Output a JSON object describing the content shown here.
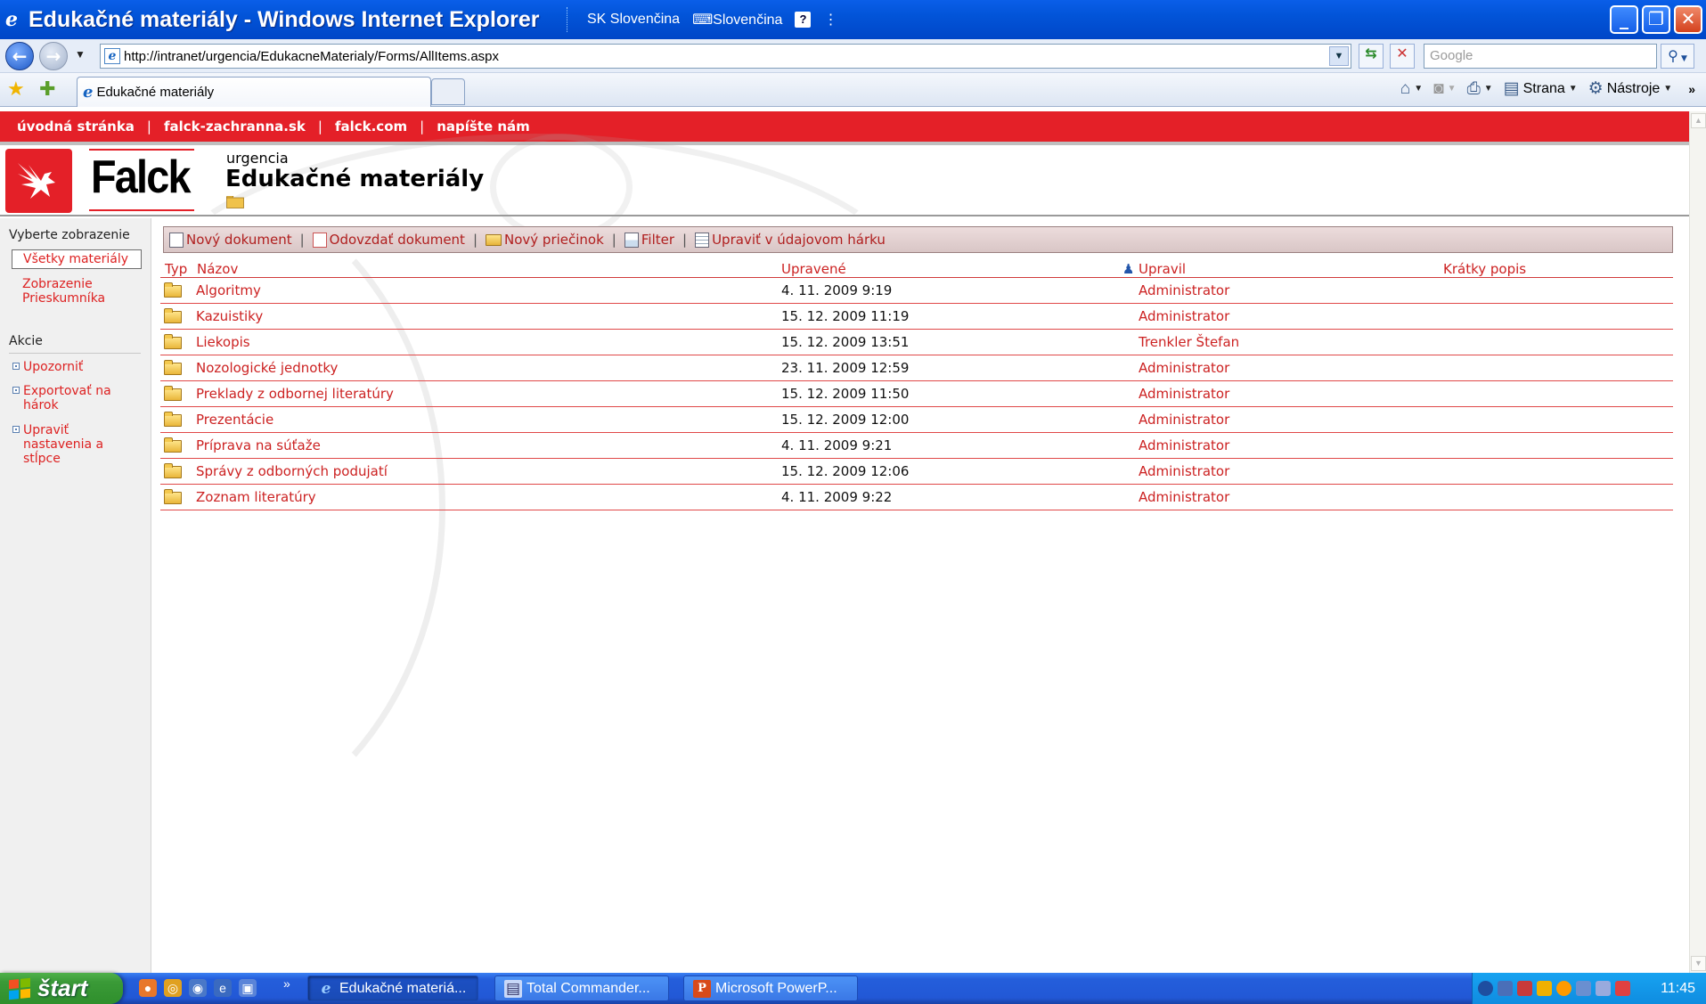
{
  "window": {
    "title": "Edukačné materiály - Windows Internet Explorer",
    "language_bar": {
      "lang_code_label": "SK Slovenčina",
      "keyboard_label": "Slovenčina",
      "help_label": "?"
    }
  },
  "address_bar": {
    "url": "http://intranet/urgencia/EdukacneMaterialy/Forms/AllItems.aspx",
    "search_placeholder": "Google"
  },
  "tabs": [
    {
      "label": "Edukačné materiály"
    }
  ],
  "command_bar": {
    "page_label": "Strana",
    "tools_label": "Nástroje"
  },
  "top_nav": {
    "links": [
      "úvodná stránka",
      "falck-zachranna.sk",
      "falck.com",
      "napíšte nám"
    ],
    "separator": "|"
  },
  "header": {
    "logo_text": "Falck",
    "site_name": "urgencia",
    "page_title": "Edukačné materiály"
  },
  "left_nav": {
    "views_heading": "Vyberte zobrazenie",
    "views": [
      "Všetky materiály",
      "Zobrazenie Prieskumníka"
    ],
    "actions_heading": "Akcie",
    "actions": [
      "Upozorniť",
      "Exportovať na hárok",
      "Upraviť nastavenia a stĺpce"
    ]
  },
  "toolbar": {
    "new_document": "Nový dokument",
    "upload_document": "Odovzdať dokument",
    "new_folder": "Nový priečinok",
    "filter": "Filter",
    "edit_datasheet": "Upraviť v údajovom hárku",
    "separator": "|"
  },
  "list": {
    "columns": {
      "type": "Typ",
      "name": "Názov",
      "modified": "Upravené",
      "modified_by": "Upravil",
      "description": "Krátky popis"
    },
    "rows": [
      {
        "name": "Algoritmy",
        "modified": "4. 11. 2009 9:19",
        "modified_by": "Administrator"
      },
      {
        "name": "Kazuistiky",
        "modified": "15. 12. 2009 11:19",
        "modified_by": "Administrator"
      },
      {
        "name": "Liekopis",
        "modified": "15. 12. 2009 13:51",
        "modified_by": "Trenkler Štefan"
      },
      {
        "name": "Nozologické jednotky",
        "modified": "23. 11. 2009 12:59",
        "modified_by": "Administrator"
      },
      {
        "name": "Preklady z odbornej literatúry",
        "modified": "15. 12. 2009 11:50",
        "modified_by": "Administrator"
      },
      {
        "name": "Prezentácie",
        "modified": "15. 12. 2009 12:00",
        "modified_by": "Administrator"
      },
      {
        "name": "Príprava na súťaže",
        "modified": "4. 11. 2009 9:21",
        "modified_by": "Administrator"
      },
      {
        "name": "Správy z odborných podujatí",
        "modified": "15. 12. 2009 12:06",
        "modified_by": "Administrator"
      },
      {
        "name": "Zoznam literatúry",
        "modified": "4. 11. 2009 9:22",
        "modified_by": "Administrator"
      }
    ]
  },
  "taskbar": {
    "start_label": "štart",
    "tasks": [
      {
        "label": "Edukačné materiá..."
      },
      {
        "label": "Total Commander..."
      },
      {
        "label": "Microsoft PowerP..."
      }
    ],
    "clock": "11:45"
  },
  "colors": {
    "accent_red": "#e42028",
    "link_red": "#cc2222",
    "xp_blue": "#245edb",
    "start_green": "#3a9a37"
  }
}
